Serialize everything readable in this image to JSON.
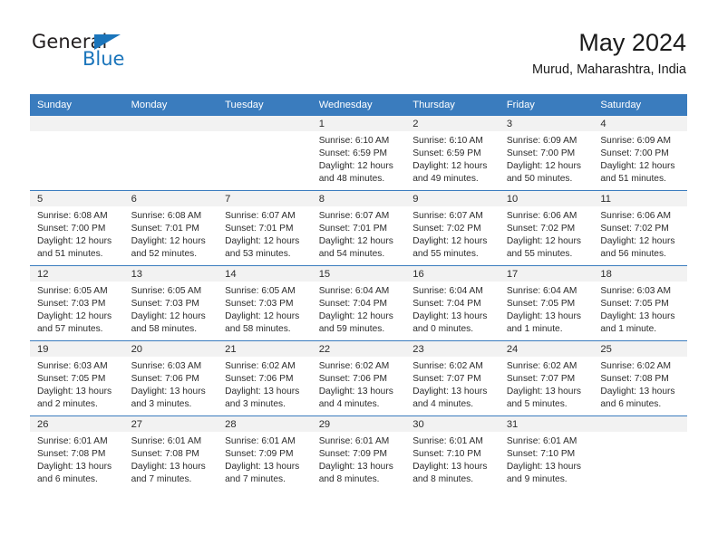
{
  "brand": {
    "name_top": "General",
    "name_bottom": "Blue",
    "flag_icon": "triangle-flag-icon",
    "accent_color": "#1b75bb"
  },
  "header": {
    "title": "May 2024",
    "subtitle": "Murud, Maharashtra, India"
  },
  "theme": {
    "header_row_bg": "#3a7cbe",
    "day_band_bg": "#f2f2f2",
    "grid_line": "#3a7cbe",
    "text": "#2b2b2b"
  },
  "weekday_headers": [
    "Sunday",
    "Monday",
    "Tuesday",
    "Wednesday",
    "Thursday",
    "Friday",
    "Saturday"
  ],
  "weeks": [
    [
      {
        "day": "",
        "empty": true
      },
      {
        "day": "",
        "empty": true
      },
      {
        "day": "",
        "empty": true
      },
      {
        "day": "1",
        "sunrise": "Sunrise: 6:10 AM",
        "sunset": "Sunset: 6:59 PM",
        "daylight1": "Daylight: 12 hours",
        "daylight2": "and 48 minutes."
      },
      {
        "day": "2",
        "sunrise": "Sunrise: 6:10 AM",
        "sunset": "Sunset: 6:59 PM",
        "daylight1": "Daylight: 12 hours",
        "daylight2": "and 49 minutes."
      },
      {
        "day": "3",
        "sunrise": "Sunrise: 6:09 AM",
        "sunset": "Sunset: 7:00 PM",
        "daylight1": "Daylight: 12 hours",
        "daylight2": "and 50 minutes."
      },
      {
        "day": "4",
        "sunrise": "Sunrise: 6:09 AM",
        "sunset": "Sunset: 7:00 PM",
        "daylight1": "Daylight: 12 hours",
        "daylight2": "and 51 minutes."
      }
    ],
    [
      {
        "day": "5",
        "sunrise": "Sunrise: 6:08 AM",
        "sunset": "Sunset: 7:00 PM",
        "daylight1": "Daylight: 12 hours",
        "daylight2": "and 51 minutes."
      },
      {
        "day": "6",
        "sunrise": "Sunrise: 6:08 AM",
        "sunset": "Sunset: 7:01 PM",
        "daylight1": "Daylight: 12 hours",
        "daylight2": "and 52 minutes."
      },
      {
        "day": "7",
        "sunrise": "Sunrise: 6:07 AM",
        "sunset": "Sunset: 7:01 PM",
        "daylight1": "Daylight: 12 hours",
        "daylight2": "and 53 minutes."
      },
      {
        "day": "8",
        "sunrise": "Sunrise: 6:07 AM",
        "sunset": "Sunset: 7:01 PM",
        "daylight1": "Daylight: 12 hours",
        "daylight2": "and 54 minutes."
      },
      {
        "day": "9",
        "sunrise": "Sunrise: 6:07 AM",
        "sunset": "Sunset: 7:02 PM",
        "daylight1": "Daylight: 12 hours",
        "daylight2": "and 55 minutes."
      },
      {
        "day": "10",
        "sunrise": "Sunrise: 6:06 AM",
        "sunset": "Sunset: 7:02 PM",
        "daylight1": "Daylight: 12 hours",
        "daylight2": "and 55 minutes."
      },
      {
        "day": "11",
        "sunrise": "Sunrise: 6:06 AM",
        "sunset": "Sunset: 7:02 PM",
        "daylight1": "Daylight: 12 hours",
        "daylight2": "and 56 minutes."
      }
    ],
    [
      {
        "day": "12",
        "sunrise": "Sunrise: 6:05 AM",
        "sunset": "Sunset: 7:03 PM",
        "daylight1": "Daylight: 12 hours",
        "daylight2": "and 57 minutes."
      },
      {
        "day": "13",
        "sunrise": "Sunrise: 6:05 AM",
        "sunset": "Sunset: 7:03 PM",
        "daylight1": "Daylight: 12 hours",
        "daylight2": "and 58 minutes."
      },
      {
        "day": "14",
        "sunrise": "Sunrise: 6:05 AM",
        "sunset": "Sunset: 7:03 PM",
        "daylight1": "Daylight: 12 hours",
        "daylight2": "and 58 minutes."
      },
      {
        "day": "15",
        "sunrise": "Sunrise: 6:04 AM",
        "sunset": "Sunset: 7:04 PM",
        "daylight1": "Daylight: 12 hours",
        "daylight2": "and 59 minutes."
      },
      {
        "day": "16",
        "sunrise": "Sunrise: 6:04 AM",
        "sunset": "Sunset: 7:04 PM",
        "daylight1": "Daylight: 13 hours",
        "daylight2": "and 0 minutes."
      },
      {
        "day": "17",
        "sunrise": "Sunrise: 6:04 AM",
        "sunset": "Sunset: 7:05 PM",
        "daylight1": "Daylight: 13 hours",
        "daylight2": "and 1 minute."
      },
      {
        "day": "18",
        "sunrise": "Sunrise: 6:03 AM",
        "sunset": "Sunset: 7:05 PM",
        "daylight1": "Daylight: 13 hours",
        "daylight2": "and 1 minute."
      }
    ],
    [
      {
        "day": "19",
        "sunrise": "Sunrise: 6:03 AM",
        "sunset": "Sunset: 7:05 PM",
        "daylight1": "Daylight: 13 hours",
        "daylight2": "and 2 minutes."
      },
      {
        "day": "20",
        "sunrise": "Sunrise: 6:03 AM",
        "sunset": "Sunset: 7:06 PM",
        "daylight1": "Daylight: 13 hours",
        "daylight2": "and 3 minutes."
      },
      {
        "day": "21",
        "sunrise": "Sunrise: 6:02 AM",
        "sunset": "Sunset: 7:06 PM",
        "daylight1": "Daylight: 13 hours",
        "daylight2": "and 3 minutes."
      },
      {
        "day": "22",
        "sunrise": "Sunrise: 6:02 AM",
        "sunset": "Sunset: 7:06 PM",
        "daylight1": "Daylight: 13 hours",
        "daylight2": "and 4 minutes."
      },
      {
        "day": "23",
        "sunrise": "Sunrise: 6:02 AM",
        "sunset": "Sunset: 7:07 PM",
        "daylight1": "Daylight: 13 hours",
        "daylight2": "and 4 minutes."
      },
      {
        "day": "24",
        "sunrise": "Sunrise: 6:02 AM",
        "sunset": "Sunset: 7:07 PM",
        "daylight1": "Daylight: 13 hours",
        "daylight2": "and 5 minutes."
      },
      {
        "day": "25",
        "sunrise": "Sunrise: 6:02 AM",
        "sunset": "Sunset: 7:08 PM",
        "daylight1": "Daylight: 13 hours",
        "daylight2": "and 6 minutes."
      }
    ],
    [
      {
        "day": "26",
        "sunrise": "Sunrise: 6:01 AM",
        "sunset": "Sunset: 7:08 PM",
        "daylight1": "Daylight: 13 hours",
        "daylight2": "and 6 minutes."
      },
      {
        "day": "27",
        "sunrise": "Sunrise: 6:01 AM",
        "sunset": "Sunset: 7:08 PM",
        "daylight1": "Daylight: 13 hours",
        "daylight2": "and 7 minutes."
      },
      {
        "day": "28",
        "sunrise": "Sunrise: 6:01 AM",
        "sunset": "Sunset: 7:09 PM",
        "daylight1": "Daylight: 13 hours",
        "daylight2": "and 7 minutes."
      },
      {
        "day": "29",
        "sunrise": "Sunrise: 6:01 AM",
        "sunset": "Sunset: 7:09 PM",
        "daylight1": "Daylight: 13 hours",
        "daylight2": "and 8 minutes."
      },
      {
        "day": "30",
        "sunrise": "Sunrise: 6:01 AM",
        "sunset": "Sunset: 7:10 PM",
        "daylight1": "Daylight: 13 hours",
        "daylight2": "and 8 minutes."
      },
      {
        "day": "31",
        "sunrise": "Sunrise: 6:01 AM",
        "sunset": "Sunset: 7:10 PM",
        "daylight1": "Daylight: 13 hours",
        "daylight2": "and 9 minutes."
      },
      {
        "day": "",
        "empty": true
      }
    ]
  ]
}
